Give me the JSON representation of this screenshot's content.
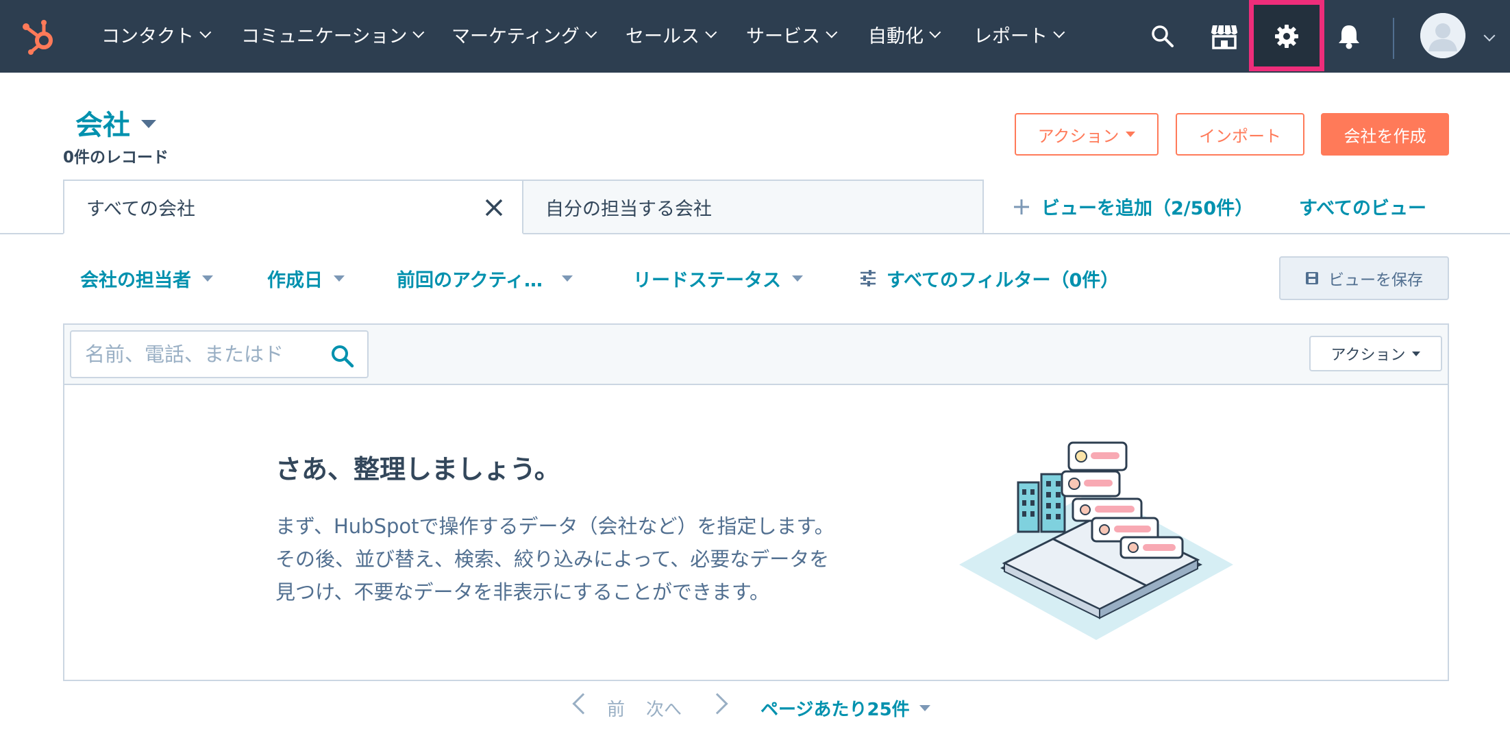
{
  "nav": {
    "items": [
      {
        "label": "コンタクト"
      },
      {
        "label": "コミュニケーション"
      },
      {
        "label": "マーケティング"
      },
      {
        "label": "セールス"
      },
      {
        "label": "サービス"
      },
      {
        "label": "自動化"
      },
      {
        "label": "レポート"
      }
    ],
    "icons": [
      "search-icon",
      "marketplace-icon",
      "settings-gear-icon",
      "notifications-bell-icon",
      "user-avatar"
    ],
    "highlight_color": "#ee2d7a",
    "bg_color": "#2d3e50"
  },
  "header": {
    "title": "会社",
    "record_count": "0件のレコード",
    "actions_label": "アクション",
    "import_label": "インポート",
    "create_label": "会社を作成"
  },
  "tabs": {
    "items": [
      {
        "label": "すべての会社",
        "active": true
      },
      {
        "label": "自分の担当する会社",
        "active": false
      }
    ],
    "add_view": "ビューを追加（2/50件）",
    "all_views": "すべてのビュー"
  },
  "filters": {
    "items": [
      {
        "label": "会社の担当者"
      },
      {
        "label": "作成日"
      },
      {
        "label": "前回のアクティ…"
      },
      {
        "label": "リードステータス"
      }
    ],
    "all_filters": "すべてのフィルター（0件）",
    "save_view": "ビューを保存"
  },
  "table": {
    "search_placeholder": "名前、電話、またはド",
    "actions_label": "アクション",
    "empty_title": "さあ、整理しましょう。",
    "empty_body_1": "まず、HubSpotで操作するデータ（会社など）を指定します。",
    "empty_body_2": "その後、並び替え、検索、絞り込みによって、必要なデータを",
    "empty_body_3": "見つけ、不要なデータを非表示にすることができます。"
  },
  "pagination": {
    "prev": "前",
    "next": "次へ",
    "per_page": "ページあたり25件"
  },
  "colors": {
    "accent": "#0091ae",
    "primary_button": "#ff7a59",
    "text": "#33475b"
  }
}
